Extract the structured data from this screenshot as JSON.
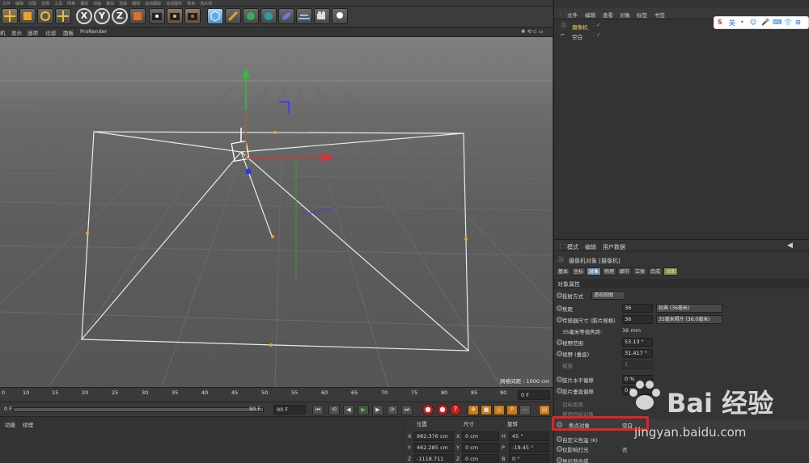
{
  "menubar": {
    "items": [
      "文件",
      "编辑",
      "创建",
      "选择",
      "工具",
      "网格",
      "捕捉",
      "动画",
      "模拟",
      "渲染",
      "雕刻",
      "运动跟踪",
      "运动图形",
      "角色",
      "流水线",
      "插件",
      "脚本",
      "窗口",
      "帮助"
    ]
  },
  "toolbar": {
    "axis_x": "X",
    "axis_y": "Y",
    "axis_z": "Z"
  },
  "viewport_menu": {
    "items": [
      "机",
      "显示",
      "选项",
      "过滤",
      "面板",
      "ProRender"
    ]
  },
  "viewport": {
    "grid_distance": "网格间距 : 1000 cm",
    "colors": {
      "axis_x": "#e23030",
      "axis_y": "#30c030",
      "axis_z": "#3a3aff",
      "camera_frame": "#dff0e8"
    }
  },
  "timeline": {
    "ticks": [
      "0",
      "10",
      "15",
      "20",
      "25",
      "30",
      "35",
      "40",
      "45",
      "50",
      "55",
      "60",
      "65",
      "70",
      "75",
      "80",
      "85",
      "90"
    ],
    "current_frame": "0 F"
  },
  "playbar": {
    "start_field": "0 F",
    "end_field": "90 F",
    "end_field2": "90 F"
  },
  "material_panel": {
    "tabs": [
      "功能",
      "纹理"
    ]
  },
  "coord_panel": {
    "headers": [
      "位置",
      "尺寸",
      "旋转"
    ],
    "position": {
      "x": "982.376 cm",
      "y": "462.285 cm",
      "z": "-1118.711 cm"
    },
    "size": {
      "x": "0 cm",
      "y": "0 cm",
      "z": "0 cm"
    },
    "rotation": {
      "h": "45 °",
      "p": "-19.45 °",
      "b": "0 °"
    },
    "labels": {
      "x": "X",
      "y": "Y",
      "z": "Z",
      "h": "H",
      "p": "P",
      "b": "B"
    }
  },
  "object_manager": {
    "menu": [
      "文件",
      "编辑",
      "查看",
      "对象",
      "标签",
      "书签"
    ],
    "objects": [
      {
        "name": "摄像机"
      },
      {
        "name": "空白"
      }
    ]
  },
  "ime": {
    "brand": "S",
    "lang": "英"
  },
  "attribute_manager": {
    "menu": [
      "模式",
      "编辑",
      "用户数据"
    ],
    "object_title": "摄像机对象 [摄像机]",
    "tabs": [
      "基本",
      "坐标",
      "对象",
      "物理",
      "细节",
      "立体",
      "合成",
      "球面"
    ],
    "active_tab": "对象",
    "section_title": "对象属性",
    "rows": {
      "projection": {
        "label": "投射方式",
        "value": "透视视图"
      },
      "focal": {
        "label": "焦距",
        "value": "36",
        "dropdown": "经典 (36毫米)"
      },
      "sensor": {
        "label": "传感器尺寸 (胶片规格)",
        "value": "36",
        "dropdown": "35毫米照片 (36.0毫米)"
      },
      "equiv": {
        "label": "35毫米等值焦距:",
        "value": "36 mm"
      },
      "fov": {
        "label": "视野范围",
        "value": "53.13 °"
      },
      "fov_v": {
        "label": "视野 (垂直)",
        "value": "31.417 °"
      },
      "zoom": {
        "label": "缩放",
        "value": "1"
      },
      "film_h": {
        "label": "胶片水平偏移",
        "value": "0 %"
      },
      "film_v": {
        "label": "胶片垂直偏移",
        "value": "0 %"
      },
      "target_dist": {
        "label": "目标距离"
      },
      "use_target": {
        "label": "使用目标对象"
      },
      "focus_obj": {
        "label": "焦点对象",
        "value": "空白"
      },
      "custom_temp": {
        "label": "自定义色温 (K)"
      },
      "affect_light": {
        "label": "仅影响灯光",
        "value": "否"
      },
      "export": {
        "label": "导出到合成"
      }
    }
  },
  "watermark": {
    "text1": "Bai 经验",
    "text2": "jingyan.baidu.com"
  }
}
